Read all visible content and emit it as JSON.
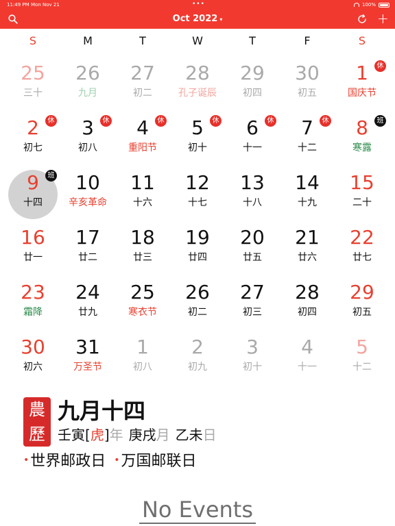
{
  "status_bar": {
    "time": "11:49 PM",
    "date": "Mon Nov 21",
    "battery": "100%"
  },
  "toolbar": {
    "title": "Oct 2022",
    "title_caret": "▾",
    "search_icon": "search-icon",
    "refresh_icon": "refresh-icon",
    "add_label": "+"
  },
  "weekdays": [
    "S",
    "M",
    "T",
    "W",
    "T",
    "F",
    "S"
  ],
  "calendar": {
    "weeks": [
      [
        {
          "day": "25",
          "lunar": "三十",
          "dim": true,
          "weekend": true
        },
        {
          "day": "26",
          "lunar": "九月",
          "dim": true,
          "term": true
        },
        {
          "day": "27",
          "lunar": "初二",
          "dim": true
        },
        {
          "day": "28",
          "lunar": "孔子诞辰",
          "dim": true,
          "festival": true
        },
        {
          "day": "29",
          "lunar": "初四",
          "dim": true
        },
        {
          "day": "30",
          "lunar": "初五",
          "dim": true
        },
        {
          "day": "1",
          "lunar": "国庆节",
          "weekend": true,
          "festival": true,
          "badge": "休",
          "badge_type": "rest"
        }
      ],
      [
        {
          "day": "2",
          "lunar": "初七",
          "weekend": true,
          "badge": "休",
          "badge_type": "rest"
        },
        {
          "day": "3",
          "lunar": "初八",
          "badge": "休",
          "badge_type": "rest"
        },
        {
          "day": "4",
          "lunar": "重阳节",
          "festival": true,
          "badge": "休",
          "badge_type": "rest"
        },
        {
          "day": "5",
          "lunar": "初十",
          "badge": "休",
          "badge_type": "rest"
        },
        {
          "day": "6",
          "lunar": "十一",
          "badge": "休",
          "badge_type": "rest"
        },
        {
          "day": "7",
          "lunar": "十二",
          "badge": "休",
          "badge_type": "rest"
        },
        {
          "day": "8",
          "lunar": "寒露",
          "weekend": true,
          "term": true,
          "badge": "班",
          "badge_type": "work"
        }
      ],
      [
        {
          "day": "9",
          "lunar": "十四",
          "weekend": true,
          "selected": true,
          "badge": "班",
          "badge_type": "work"
        },
        {
          "day": "10",
          "lunar": "辛亥革命",
          "festival": true
        },
        {
          "day": "11",
          "lunar": "十六"
        },
        {
          "day": "12",
          "lunar": "十七"
        },
        {
          "day": "13",
          "lunar": "十八"
        },
        {
          "day": "14",
          "lunar": "十九"
        },
        {
          "day": "15",
          "lunar": "二十",
          "weekend": true
        }
      ],
      [
        {
          "day": "16",
          "lunar": "廿一",
          "weekend": true
        },
        {
          "day": "17",
          "lunar": "廿二"
        },
        {
          "day": "18",
          "lunar": "廿三"
        },
        {
          "day": "19",
          "lunar": "廿四"
        },
        {
          "day": "20",
          "lunar": "廿五"
        },
        {
          "day": "21",
          "lunar": "廿六"
        },
        {
          "day": "22",
          "lunar": "廿七",
          "weekend": true
        }
      ],
      [
        {
          "day": "23",
          "lunar": "霜降",
          "weekend": true,
          "term": true
        },
        {
          "day": "24",
          "lunar": "廿九"
        },
        {
          "day": "25",
          "lunar": "寒衣节",
          "festival": true
        },
        {
          "day": "26",
          "lunar": "初二"
        },
        {
          "day": "27",
          "lunar": "初三"
        },
        {
          "day": "28",
          "lunar": "初四"
        },
        {
          "day": "29",
          "lunar": "初五",
          "weekend": true
        }
      ],
      [
        {
          "day": "30",
          "lunar": "初六",
          "weekend": true
        },
        {
          "day": "31",
          "lunar": "万圣节",
          "festival": true
        },
        {
          "day": "1",
          "lunar": "初八",
          "dim": true
        },
        {
          "day": "2",
          "lunar": "初九",
          "dim": true
        },
        {
          "day": "3",
          "lunar": "初十",
          "dim": true
        },
        {
          "day": "4",
          "lunar": "十一",
          "dim": true
        },
        {
          "day": "5",
          "lunar": "十二",
          "dim": true,
          "weekend": true
        }
      ]
    ]
  },
  "selected_day": {
    "seal_top": "農",
    "seal_bottom": "歷",
    "lunar_date": "九月十四",
    "year_stem": "壬寅",
    "year_bracket_open": "[",
    "year_animal": "虎",
    "year_bracket_close": "]",
    "year_unit": "年",
    "month_stem": "庚戌",
    "month_unit": "月",
    "day_stem": "乙未",
    "day_unit": "日",
    "observances": [
      "世界邮政日",
      "万国邮联日"
    ],
    "bullet": "•"
  },
  "events": {
    "empty_label": "No Events"
  },
  "colors": {
    "accent": "#f2392f",
    "weekend": "#e8402f",
    "rest_badge": "#e8302a",
    "work_badge": "#111111",
    "solar_term": "#2a8a4a"
  }
}
